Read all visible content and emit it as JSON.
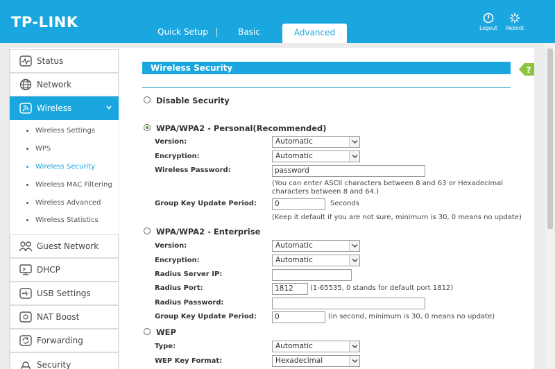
{
  "header": {
    "logo": "TP-LINK",
    "tabs": {
      "quick_setup": "Quick Setup",
      "basic": "Basic",
      "advanced": "Advanced"
    },
    "logout": "Logout",
    "reboot": "Reboot",
    "colors": {
      "brand": "#1aa7e0"
    }
  },
  "sidebar": {
    "items": [
      {
        "label": "Status",
        "icon": "status-icon"
      },
      {
        "label": "Network",
        "icon": "globe-icon"
      },
      {
        "label": "Wireless",
        "icon": "wireless-icon"
      },
      {
        "label": "Guest Network",
        "icon": "guest-users-icon"
      },
      {
        "label": "DHCP",
        "icon": "dhcp-icon"
      },
      {
        "label": "USB Settings",
        "icon": "usb-icon"
      },
      {
        "label": "NAT Boost",
        "icon": "nat-icon"
      },
      {
        "label": "Forwarding",
        "icon": "forwarding-icon"
      },
      {
        "label": "Security",
        "icon": "lock-icon"
      }
    ],
    "wireless_sub": [
      "Wireless Settings",
      "WPS",
      "Wireless Security",
      "Wireless MAC Filtering",
      "Wireless Advanced",
      "Wireless Statistics"
    ]
  },
  "main": {
    "title": "Wireless Security",
    "disable": "Disable Security",
    "personal": {
      "title": "WPA/WPA2 - Personal(Recommended)",
      "version_label": "Version:",
      "version_value": "Automatic",
      "encryption_label": "Encryption:",
      "encryption_value": "Automatic",
      "password_label": "Wireless Password:",
      "password_value": "password",
      "password_note_1": "(You can enter ASCII characters between 8 and 63 or Hexadecimal",
      "password_note_2": "characters between 8 and 64.)",
      "gkup_label": "Group Key Update Period:",
      "gkup_value": "0",
      "gkup_unit": "Seconds",
      "gkup_note": "(Keep it default if you are not sure, minimum is 30, 0 means no update)"
    },
    "enterprise": {
      "title": "WPA/WPA2 - Enterprise",
      "version_label": "Version:",
      "version_value": "Automatic",
      "encryption_label": "Encryption:",
      "encryption_value": "Automatic",
      "radius_ip_label": "Radius Server IP:",
      "radius_ip_value": "",
      "radius_port_label": "Radius Port:",
      "radius_port_value": "1812",
      "radius_port_note": "(1-65535, 0 stands for default port 1812)",
      "radius_pw_label": "Radius Password:",
      "radius_pw_value": "",
      "gkup_label": "Group Key Update Period:",
      "gkup_value": "0",
      "gkup_note": "(in second, minimum is 30, 0 means no update)"
    },
    "wep": {
      "title": "WEP",
      "type_label": "Type:",
      "type_value": "Automatic",
      "format_label": "WEP Key Format:",
      "format_value": "Hexadecimal"
    }
  }
}
